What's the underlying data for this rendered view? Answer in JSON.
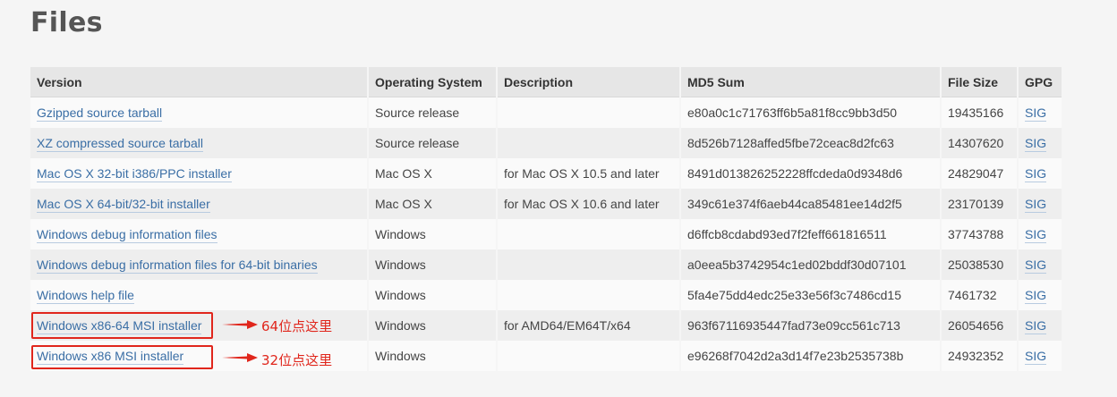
{
  "page": {
    "title": "Files"
  },
  "table": {
    "headers": [
      "Version",
      "Operating System",
      "Description",
      "MD5 Sum",
      "File Size",
      "GPG"
    ],
    "rows": [
      {
        "version": "Gzipped source tarball",
        "os": "Source release",
        "description": "",
        "md5": "e80a0c1c71763ff6b5a81f8cc9bb3d50",
        "size": "19435166",
        "gpg": "SIG"
      },
      {
        "version": "XZ compressed source tarball",
        "os": "Source release",
        "description": "",
        "md5": "8d526b7128affed5fbe72ceac8d2fc63",
        "size": "14307620",
        "gpg": "SIG"
      },
      {
        "version": "Mac OS X 32-bit i386/PPC installer",
        "os": "Mac OS X",
        "description": "for Mac OS X 10.5 and later",
        "md5": "8491d013826252228ffcdeda0d9348d6",
        "size": "24829047",
        "gpg": "SIG"
      },
      {
        "version": "Mac OS X 64-bit/32-bit installer",
        "os": "Mac OS X",
        "description": "for Mac OS X 10.6 and later",
        "md5": "349c61e374f6aeb44ca85481ee14d2f5",
        "size": "23170139",
        "gpg": "SIG"
      },
      {
        "version": "Windows debug information files",
        "os": "Windows",
        "description": "",
        "md5": "d6ffcb8cdabd93ed7f2feff661816511",
        "size": "37743788",
        "gpg": "SIG"
      },
      {
        "version": "Windows debug information files for 64-bit binaries",
        "os": "Windows",
        "description": "",
        "md5": "a0eea5b3742954c1ed02bddf30d07101",
        "size": "25038530",
        "gpg": "SIG"
      },
      {
        "version": "Windows help file",
        "os": "Windows",
        "description": "",
        "md5": "5fa4e75dd4edc25e33e56f3c7486cd15",
        "size": "7461732",
        "gpg": "SIG"
      },
      {
        "version": "Windows x86-64 MSI installer",
        "os": "Windows",
        "description": "for AMD64/EM64T/x64",
        "md5": "963f67116935447fad73e09cc561c713",
        "size": "26054656",
        "gpg": "SIG"
      },
      {
        "version": "Windows x86 MSI installer",
        "os": "Windows",
        "description": "",
        "md5": "e96268f7042d2a3d14f7e23b2535738b",
        "size": "24932352",
        "gpg": "SIG"
      }
    ]
  },
  "annotations": {
    "note_64": "64位点这里",
    "note_32": "32位点这里",
    "color": "#e0261c"
  },
  "colors": {
    "link": "#3a6ea5",
    "header_bg": "#e6e6e6",
    "row_alt_bg": "#eeeeee",
    "page_bg": "#f5f5f5"
  }
}
